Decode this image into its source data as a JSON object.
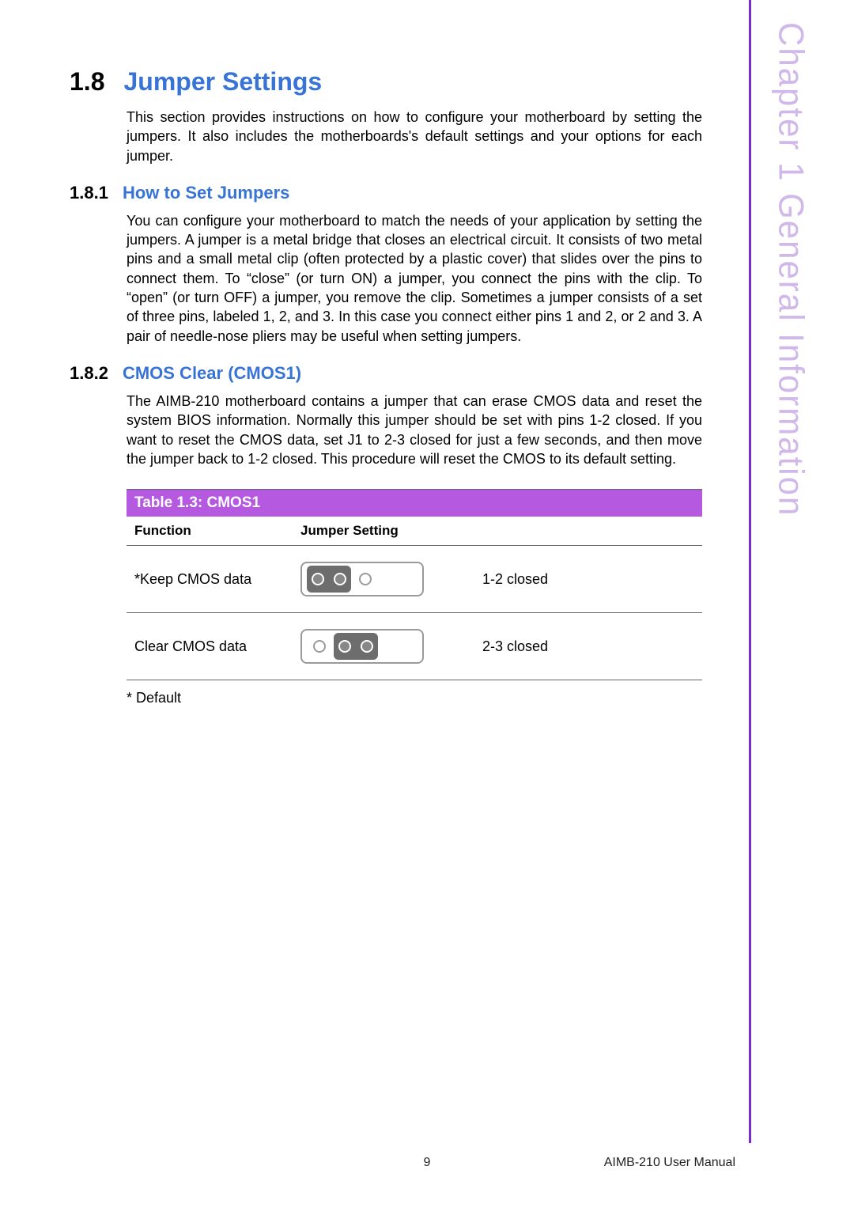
{
  "side_label": "Chapter 1   General Information",
  "section": {
    "number": "1.8",
    "title": "Jumper Settings",
    "intro": "This section provides instructions on how to configure your motherboard by setting the jumpers. It also includes the motherboards's default settings and your options for each jumper."
  },
  "sub1": {
    "number": "1.8.1",
    "title": "How to Set Jumpers",
    "body": "You can configure your motherboard to match the needs of your application by setting the jumpers. A jumper is a metal bridge that closes an electrical circuit. It consists of two metal pins and a small metal clip (often protected by a plastic cover) that slides over the pins to connect them. To “close” (or turn ON) a jumper, you connect the pins with the clip. To “open” (or turn OFF) a jumper, you remove the clip. Sometimes a jumper consists of a set of three pins, labeled 1, 2, and 3. In this case you connect either pins 1 and 2, or 2 and 3. A pair of needle-nose pliers may be useful when setting jumpers."
  },
  "sub2": {
    "number": "1.8.2",
    "title": "CMOS Clear (CMOS1)",
    "body": "The AIMB-210 motherboard contains a jumper that can erase CMOS data and reset the system BIOS information. Normally this jumper should be set with pins 1-2 closed. If you want to reset the CMOS data, set J1 to 2-3 closed for just a few seconds, and then move the jumper back to 1-2 closed. This procedure will reset the CMOS to its default setting."
  },
  "table": {
    "caption": "Table 1.3: CMOS1",
    "headers": {
      "function": "Function",
      "setting": "Jumper Setting"
    },
    "rows": [
      {
        "function": "*Keep CMOS data",
        "jumper_icon": "jumper-1-2",
        "desc": "1-2 closed"
      },
      {
        "function": "Clear CMOS data",
        "jumper_icon": "jumper-2-3",
        "desc": "2-3 closed"
      }
    ],
    "note": "* Default"
  },
  "footer": {
    "page": "9",
    "doc": "AIMB-210 User Manual"
  }
}
